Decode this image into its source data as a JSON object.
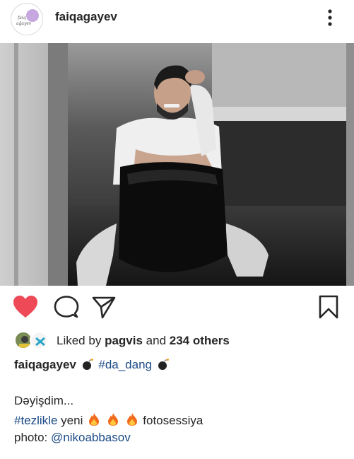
{
  "post": {
    "username": "faiqagayev",
    "avatar_logo_text": "faiq ağayev",
    "more_icon": "more-vertical-icon"
  },
  "actions": {
    "like_icon": "heart-filled-icon",
    "comment_icon": "comment-icon",
    "share_icon": "send-icon",
    "save_icon": "bookmark-icon",
    "like_color": "#ed4956"
  },
  "likes": {
    "prefix": "Liked by",
    "user": "pagvis",
    "and": "and",
    "others": "234 others"
  },
  "caption": {
    "username": "faiqagayev",
    "hashtag1": "#da_dang",
    "line2": "Dəyişdim...",
    "hashtag2": "#tezlikle",
    "word_yeni": "yeni",
    "word_fotosessiya": "fotosessiya",
    "photo_label": "photo:",
    "mention": "@nikoabbasov",
    "link_color": "#1b4a86",
    "emojis": [
      "bomb",
      "bomb",
      "fire",
      "fire",
      "fire"
    ]
  }
}
